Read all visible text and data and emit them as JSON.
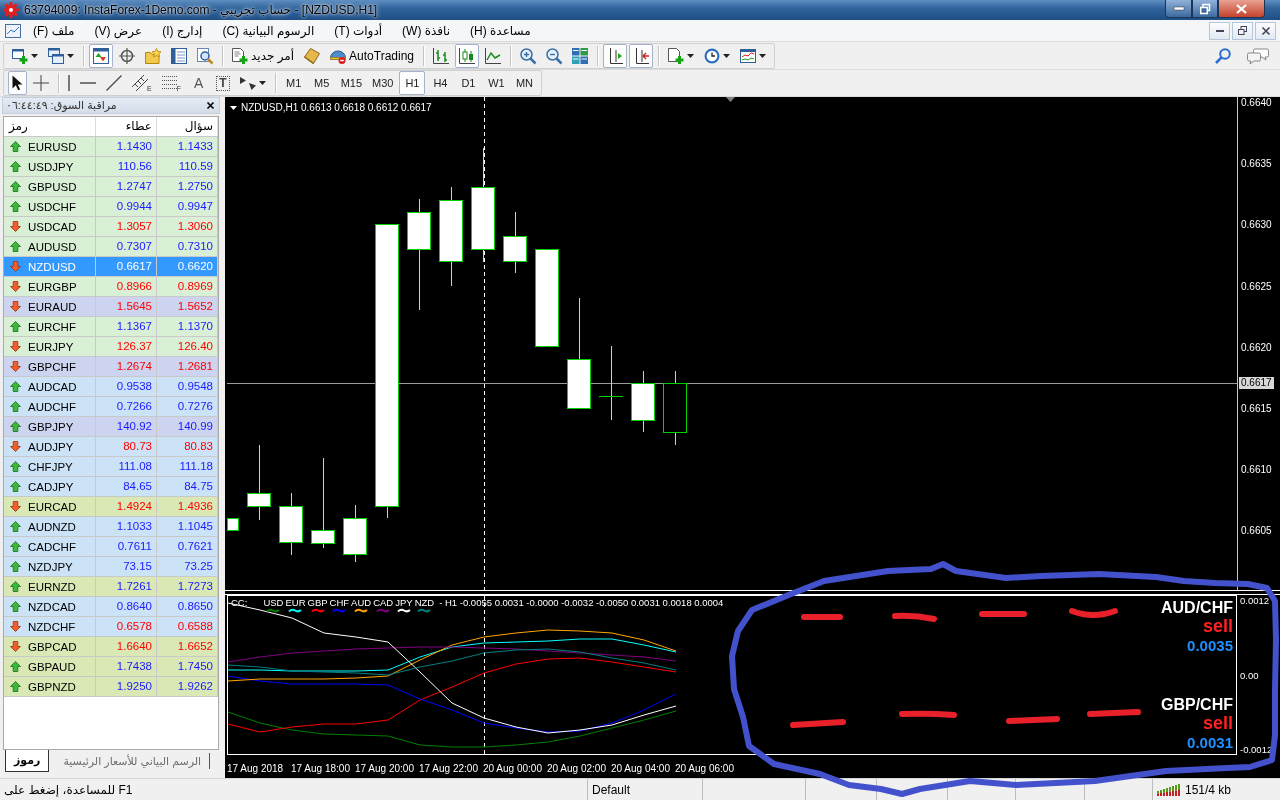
{
  "window": {
    "title": "63794009: InstaForex-1Demo.com - حساب تجريبي - [NZDUSD,H1]"
  },
  "menu": [
    "مساعدة (H)",
    "نافذة (W)",
    "أدوات (T)",
    "الرسوم البيانية (C)",
    "إدارج (I)",
    "عرض (V)",
    "ملف (F)"
  ],
  "toolbar_main": {
    "groups": [
      [
        {
          "kind": "new-chart",
          "pressed": false
        },
        {
          "kind": "profiles",
          "pressed": false
        }
      ],
      [
        {
          "kind": "market-watch",
          "pressed": true
        },
        {
          "kind": "navigator",
          "pressed": false
        },
        {
          "kind": "data-window",
          "pressed": false
        },
        {
          "kind": "terminal",
          "pressed": false
        },
        {
          "kind": "tester",
          "pressed": false
        }
      ],
      [
        {
          "kind": "new-order",
          "label": "أمر جديد",
          "pressed": false
        },
        {
          "kind": "editor",
          "pressed": false
        },
        {
          "kind": "autotrading",
          "label": "AutoTrading",
          "pressed": false
        }
      ],
      [
        {
          "kind": "bar-chart",
          "pressed": false
        },
        {
          "kind": "candles",
          "pressed": true
        },
        {
          "kind": "line-chart",
          "pressed": false
        }
      ],
      [
        {
          "kind": "zoom-in",
          "pressed": false
        },
        {
          "kind": "zoom-out",
          "pressed": false
        },
        {
          "kind": "tile",
          "pressed": false
        }
      ],
      [
        {
          "kind": "chart-shift",
          "pressed": true
        },
        {
          "kind": "autoscroll",
          "pressed": true
        }
      ],
      [
        {
          "kind": "indicators",
          "pressed": false
        },
        {
          "kind": "periods",
          "pressed": false
        },
        {
          "kind": "templates",
          "pressed": false
        }
      ]
    ]
  },
  "toolbar_tools": {
    "groups": [
      [
        {
          "kind": "cursor",
          "pressed": true
        },
        {
          "kind": "crosshair",
          "pressed": false
        }
      ],
      [
        {
          "kind": "vertical-line",
          "pressed": false
        },
        {
          "kind": "horizontal-line",
          "pressed": false
        },
        {
          "kind": "trendline",
          "pressed": false
        },
        {
          "kind": "channel",
          "label": "E",
          "pressed": false
        },
        {
          "kind": "fibonacci",
          "label": "F",
          "pressed": false
        },
        {
          "kind": "text",
          "label": "A",
          "pressed": false
        },
        {
          "kind": "text-label",
          "label": "T",
          "pressed": false
        },
        {
          "kind": "arrows",
          "pressed": false
        }
      ]
    ],
    "timeframes": [
      {
        "label": "M1",
        "selected": false
      },
      {
        "label": "M5",
        "selected": false
      },
      {
        "label": "M15",
        "selected": false
      },
      {
        "label": "M30",
        "selected": false
      },
      {
        "label": "H1",
        "selected": true
      },
      {
        "label": "H4",
        "selected": false
      },
      {
        "label": "D1",
        "selected": false
      },
      {
        "label": "W1",
        "selected": false
      },
      {
        "label": "MN",
        "selected": false
      }
    ]
  },
  "market_watch": {
    "title": "مراقبة السوق: ٠٦:٤٤:٤٩",
    "columns": [
      "سؤال",
      "عطاء",
      "رمز"
    ],
    "rows": [
      {
        "symbol": "EURUSD",
        "bid": "1.1430",
        "ask": "1.1433",
        "rising": true,
        "selected": false,
        "color": "#d9f0d6"
      },
      {
        "symbol": "USDJPY",
        "bid": "110.56",
        "ask": "110.59",
        "rising": true,
        "selected": false,
        "color": "#d9f0d6"
      },
      {
        "symbol": "GBPUSD",
        "bid": "1.2747",
        "ask": "1.2750",
        "rising": true,
        "selected": false,
        "color": "#d9f0d6"
      },
      {
        "symbol": "USDCHF",
        "bid": "0.9944",
        "ask": "0.9947",
        "rising": true,
        "selected": false,
        "color": "#d9f0d6"
      },
      {
        "symbol": "USDCAD",
        "bid": "1.3057",
        "ask": "1.3060",
        "rising": false,
        "selected": false,
        "color": "#d9f0d6"
      },
      {
        "symbol": "AUDUSD",
        "bid": "0.7307",
        "ask": "0.7310",
        "rising": true,
        "selected": false,
        "color": "#d9f0d6"
      },
      {
        "symbol": "NZDUSD",
        "bid": "0.6617",
        "ask": "0.6620",
        "rising": false,
        "selected": true
      },
      {
        "symbol": "EURGBP",
        "bid": "0.8966",
        "ask": "0.8969",
        "rising": false,
        "selected": false,
        "color": "#d9f0d6"
      },
      {
        "symbol": "EURAUD",
        "bid": "1.5645",
        "ask": "1.5652",
        "rising": false,
        "selected": false,
        "color": "#cdd4f0"
      },
      {
        "symbol": "EURCHF",
        "bid": "1.1367",
        "ask": "1.1370",
        "rising": true,
        "selected": false,
        "color": "#d9f0d6"
      },
      {
        "symbol": "EURJPY",
        "bid": "126.37",
        "ask": "126.40",
        "rising": false,
        "selected": false,
        "color": "#d9f0d6"
      },
      {
        "symbol": "GBPCHF",
        "bid": "1.2674",
        "ask": "1.2681",
        "rising": false,
        "selected": false,
        "color": "#cdd4f0"
      },
      {
        "symbol": "AUDCAD",
        "bid": "0.9538",
        "ask": "0.9548",
        "rising": true,
        "selected": false,
        "color": "#cce3f7"
      },
      {
        "symbol": "AUDCHF",
        "bid": "0.7266",
        "ask": "0.7276",
        "rising": true,
        "selected": false,
        "color": "#cce3f7"
      },
      {
        "symbol": "GBPJPY",
        "bid": "140.92",
        "ask": "140.99",
        "rising": true,
        "selected": false,
        "color": "#cdd4f0"
      },
      {
        "symbol": "AUDJPY",
        "bid": "80.73",
        "ask": "80.83",
        "rising": false,
        "selected": false,
        "color": "#cce3f7"
      },
      {
        "symbol": "CHFJPY",
        "bid": "111.08",
        "ask": "111.18",
        "rising": true,
        "selected": false,
        "color": "#cce3f7"
      },
      {
        "symbol": "CADJPY",
        "bid": "84.65",
        "ask": "84.75",
        "rising": true,
        "selected": false,
        "color": "#cce3f7"
      },
      {
        "symbol": "EURCAD",
        "bid": "1.4924",
        "ask": "1.4936",
        "rising": false,
        "selected": false,
        "color": "#d9e8b4"
      },
      {
        "symbol": "AUDNZD",
        "bid": "1.1033",
        "ask": "1.1045",
        "rising": true,
        "selected": false,
        "color": "#cce3f7"
      },
      {
        "symbol": "CADCHF",
        "bid": "0.7611",
        "ask": "0.7621",
        "rising": true,
        "selected": false,
        "color": "#cce3f7"
      },
      {
        "symbol": "NZDJPY",
        "bid": "73.15",
        "ask": "73.25",
        "rising": true,
        "selected": false,
        "color": "#cce3f7"
      },
      {
        "symbol": "EURNZD",
        "bid": "1.7261",
        "ask": "1.7273",
        "rising": true,
        "selected": false,
        "color": "#d9e8b4"
      },
      {
        "symbol": "NZDCAD",
        "bid": "0.8640",
        "ask": "0.8650",
        "rising": true,
        "selected": false,
        "color": "#cce3f7"
      },
      {
        "symbol": "NZDCHF",
        "bid": "0.6578",
        "ask": "0.6588",
        "rising": false,
        "selected": false,
        "color": "#cce3f7"
      },
      {
        "symbol": "GBPCAD",
        "bid": "1.6640",
        "ask": "1.6652",
        "rising": false,
        "selected": false,
        "color": "#d9e8b4"
      },
      {
        "symbol": "GBPAUD",
        "bid": "1.7438",
        "ask": "1.7450",
        "rising": true,
        "selected": false,
        "color": "#d9e8b4"
      },
      {
        "symbol": "GBPNZD",
        "bid": "1.9250",
        "ask": "1.9262",
        "rising": true,
        "selected": false,
        "color": "#d9e8b4"
      }
    ],
    "tabs": [
      {
        "label": "الرسم البياني للأسعار الرئيسية",
        "selected": false
      },
      {
        "label": "رموز",
        "selected": true
      }
    ]
  },
  "chart": {
    "header": "NZDUSD,H1 0.6613 0.6618 0.6612 0.6617",
    "price_axis": [
      "0.6640",
      "0.6635",
      "0.6630",
      "0.6625",
      "0.6620",
      "0.6615",
      "0.6610",
      "0.6605"
    ],
    "current_price": "0.6617",
    "indicator": {
      "name": "CC:",
      "legend": [
        {
          "label": "USD",
          "color": "#008000"
        },
        {
          "label": "EUR",
          "color": "#00ffff"
        },
        {
          "label": "GBP",
          "color": "#ff0000"
        },
        {
          "label": "CHF",
          "color": "#0000ff"
        },
        {
          "label": "AUD",
          "color": "#ffa500"
        },
        {
          "label": "CAD",
          "color": "#800080"
        },
        {
          "label": "JPY",
          "color": "#ffffff"
        },
        {
          "label": "NZD",
          "color": "#008080"
        }
      ],
      "readout": "- H1 -0.0055 0.0031 -0.0000 -0.0032 -0.0050 0.0031 0.0018 0.0004",
      "axis": [
        "0.0012",
        "0.00",
        "-0.0012"
      ],
      "signals": [
        {
          "pair": "AUD/CHF",
          "action": "sell",
          "value": "0.0035"
        },
        {
          "pair": "GBP/CHF",
          "action": "sell",
          "value": "0.0031"
        }
      ]
    },
    "time_axis": [
      "17 Aug 2018",
      "17 Aug 18:00",
      "17 Aug 20:00",
      "17 Aug 22:00",
      "20 Aug 00:00",
      "20 Aug 02:00",
      "20 Aug 04:00",
      "20 Aug 06:00"
    ]
  },
  "status_bar": {
    "help": "للمساعدة، إضغط على F1",
    "profile": "Default",
    "traffic": "151/4 kb"
  }
}
